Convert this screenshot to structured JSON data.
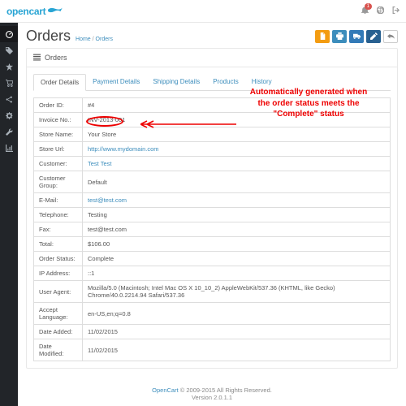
{
  "brand": "opencart",
  "notif_count": "1",
  "page_title": "Orders",
  "crumb_home": "Home",
  "crumb_page": "Orders",
  "action_btns": [
    {
      "name": "invoice-button",
      "color": "#f39c12",
      "icon": "doc"
    },
    {
      "name": "print-button",
      "color": "#3c8dbc",
      "icon": "print"
    },
    {
      "name": "ship-button",
      "color": "#337ab7",
      "icon": "truck"
    },
    {
      "name": "edit-button",
      "color": "#286090",
      "icon": "pencil"
    },
    {
      "name": "back-button",
      "color": "#fff",
      "icon": "reply",
      "fg": "#888",
      "bd": "1"
    }
  ],
  "panel_title": "Orders",
  "tabs": [
    {
      "label": "Order Details",
      "act": true
    },
    {
      "label": "Payment Details"
    },
    {
      "label": "Shipping Details"
    },
    {
      "label": "Products"
    },
    {
      "label": "History"
    }
  ],
  "rows": [
    {
      "k": "Order ID:",
      "v": "#4"
    },
    {
      "k": "Invoice No.:",
      "v": "INV-2013-001"
    },
    {
      "k": "Store Name:",
      "v": "Your Store"
    },
    {
      "k": "Store Url:",
      "v": "http://www.mydomain.com",
      "link": true
    },
    {
      "k": "Customer:",
      "v": "Test Test",
      "link": true
    },
    {
      "k": "Customer Group:",
      "v": "Default"
    },
    {
      "k": "E-Mail:",
      "v": "test@test.com",
      "link": true
    },
    {
      "k": "Telephone:",
      "v": "Testing"
    },
    {
      "k": "Fax:",
      "v": "test@test.com"
    },
    {
      "k": "Total:",
      "v": "$106.00"
    },
    {
      "k": "Order Status:",
      "v": "Complete"
    },
    {
      "k": "IP Address:",
      "v": "::1"
    },
    {
      "k": "User Agent:",
      "v": "Mozilla/5.0 (Macintosh; Intel Mac OS X 10_10_2) AppleWebKit/537.36 (KHTML, like Gecko) Chrome/40.0.2214.94 Safari/537.36"
    },
    {
      "k": "Accept Language:",
      "v": "en-US,en;q=0.8"
    },
    {
      "k": "Date Added:",
      "v": "11/02/2015"
    },
    {
      "k": "Date Modified:",
      "v": "11/02/2015"
    }
  ],
  "annotation": "Automatically generated when the order status meets the \"Complete\" status",
  "footer_brand": "OpenCart",
  "footer_text": " © 2009-2015 All Rights Reserved.",
  "footer_ver": "Version 2.0.1.1",
  "sidebar": [
    "dash",
    "tags",
    "sale",
    "cart",
    "share",
    "cog",
    "wrench",
    "chart"
  ]
}
